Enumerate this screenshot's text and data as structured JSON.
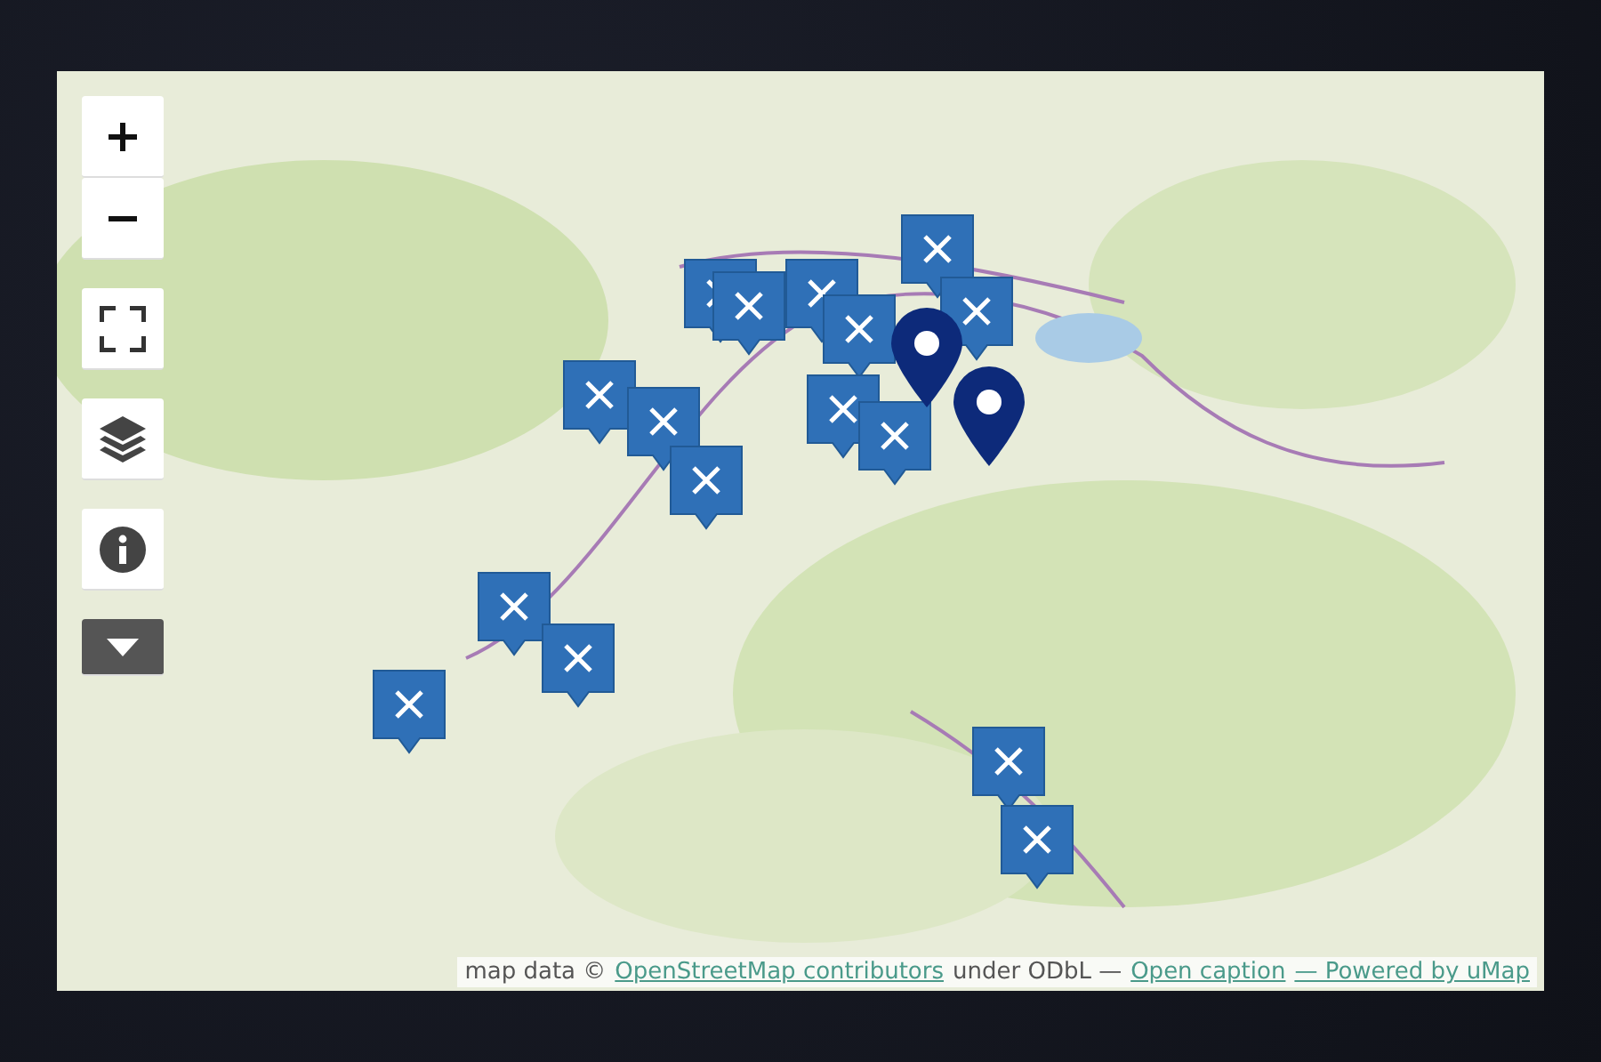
{
  "map": {
    "controls": [
      {
        "kind": "zoom-in"
      },
      {
        "kind": "zoom-out"
      },
      {
        "kind": "fullscreen"
      },
      {
        "kind": "layers"
      },
      {
        "kind": "info"
      },
      {
        "kind": "more"
      }
    ],
    "markers": [
      {
        "kind": "square"
      },
      {
        "kind": "square"
      },
      {
        "kind": "square"
      },
      {
        "kind": "square"
      },
      {
        "kind": "square"
      },
      {
        "kind": "square"
      },
      {
        "kind": "square"
      },
      {
        "kind": "square"
      },
      {
        "kind": "square"
      },
      {
        "kind": "square"
      },
      {
        "kind": "square"
      },
      {
        "kind": "square"
      },
      {
        "kind": "square"
      },
      {
        "kind": "square"
      },
      {
        "kind": "square"
      },
      {
        "kind": "square"
      },
      {
        "kind": "pin"
      },
      {
        "kind": "pin"
      }
    ],
    "attribution": [
      {
        "kind": "text",
        "text": "map data ©"
      },
      {
        "kind": "link",
        "text": "OpenStreetMap contributors"
      },
      {
        "kind": "text",
        "text": "under ODbL —"
      },
      {
        "kind": "link",
        "text": "Open caption"
      },
      {
        "kind": "link",
        "text": "— Powered by uMap"
      }
    ]
  }
}
